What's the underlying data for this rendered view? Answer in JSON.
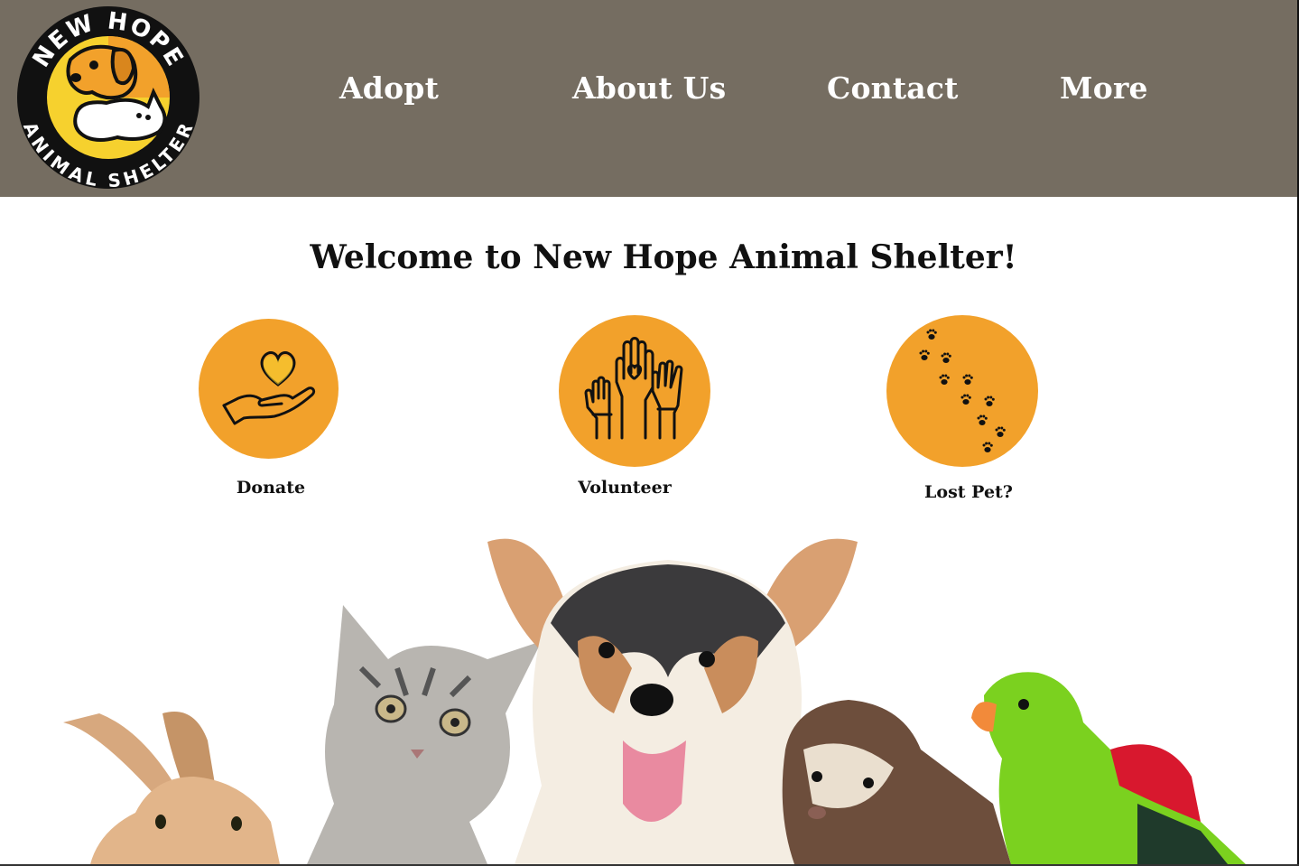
{
  "logo": {
    "top_text": "NEW HOPE",
    "bottom_text": "ANIMAL SHELTER"
  },
  "nav": {
    "items": [
      {
        "label": "Adopt"
      },
      {
        "label": "About Us"
      },
      {
        "label": "Contact"
      },
      {
        "label": "More"
      }
    ]
  },
  "main": {
    "welcome": "Welcome to New Hope Animal Shelter!",
    "actions": [
      {
        "label": "Donate",
        "icon": "heart-hand-icon"
      },
      {
        "label": "Volunteer",
        "icon": "raised-hands-icon"
      },
      {
        "label": "Lost Pet?",
        "icon": "paw-prints-icon"
      }
    ]
  },
  "hero": {
    "animals": [
      "rabbit",
      "kitten",
      "puppy",
      "ferret",
      "parrot"
    ]
  },
  "colors": {
    "header_bg": "#756d61",
    "accent_orange": "#f2a12b",
    "logo_yellow": "#f6d12e",
    "text": "#111111",
    "white": "#ffffff"
  }
}
